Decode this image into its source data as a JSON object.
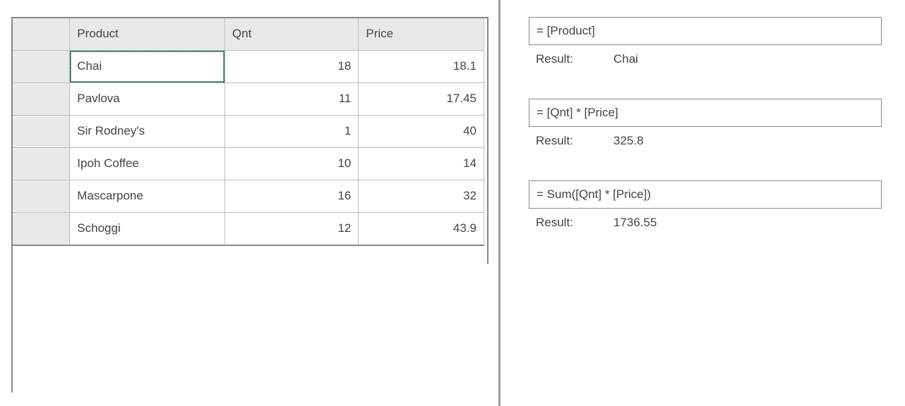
{
  "grid": {
    "columns": [
      "Product",
      "Qnt",
      "Price"
    ],
    "rows": [
      {
        "product": "Chai",
        "qnt": "18",
        "price": "18.1"
      },
      {
        "product": "Pavlova",
        "qnt": "11",
        "price": "17.45"
      },
      {
        "product": "Sir Rodney's",
        "qnt": "1",
        "price": "40"
      },
      {
        "product": "Ipoh Coffee",
        "qnt": "10",
        "price": "14"
      },
      {
        "product": "Mascarpone",
        "qnt": "16",
        "price": "32"
      },
      {
        "product": "Schoggi",
        "qnt": "12",
        "price": "43.9"
      }
    ],
    "focused_row": 0,
    "focused_col": "product"
  },
  "formula1": {
    "expression": "= [Product]",
    "result_label": "Result:",
    "result_value": "Chai"
  },
  "formula2": {
    "expression": "= [Qnt] * [Price]",
    "result_label": "Result:",
    "result_value": "325.8"
  },
  "formula3": {
    "expression": "= Sum([Qnt] * [Price])",
    "result_label": "Result:",
    "result_value": "1736.55"
  }
}
